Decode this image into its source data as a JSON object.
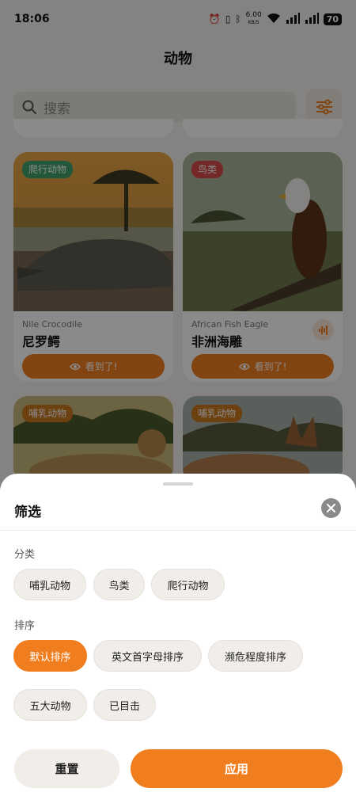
{
  "status_bar": {
    "time": "18:06",
    "net_speed": "6.00",
    "net_unit": "KB/S",
    "battery": "70"
  },
  "header": {
    "title": "动物"
  },
  "search": {
    "placeholder": "搜索"
  },
  "cards": [
    {
      "badge": "爬行动物",
      "en_name": "Nile Crocodile",
      "cn_name": "尼罗鳄",
      "seen_label": "看到了!"
    },
    {
      "badge": "鸟类",
      "en_name": "African Fish Eagle",
      "cn_name": "非洲海雕",
      "seen_label": "看到了!"
    },
    {
      "badge": "哺乳动物"
    },
    {
      "badge": "哺乳动物"
    }
  ],
  "filter_sheet": {
    "title": "筛选",
    "category_label": "分类",
    "categories": [
      "哺乳动物",
      "鸟类",
      "爬行动物"
    ],
    "sort_label": "排序",
    "sort_options": [
      "默认排序",
      "英文首字母排序",
      "濒危程度排序",
      "五大动物",
      "已目击"
    ],
    "selected_sort": "默认排序",
    "reset_label": "重置",
    "apply_label": "应用"
  },
  "colors": {
    "accent": "#f07e1e",
    "reptile_badge": "#3fa36a",
    "bird_badge": "#d94b4b",
    "mammal_badge": "#c9761e"
  }
}
